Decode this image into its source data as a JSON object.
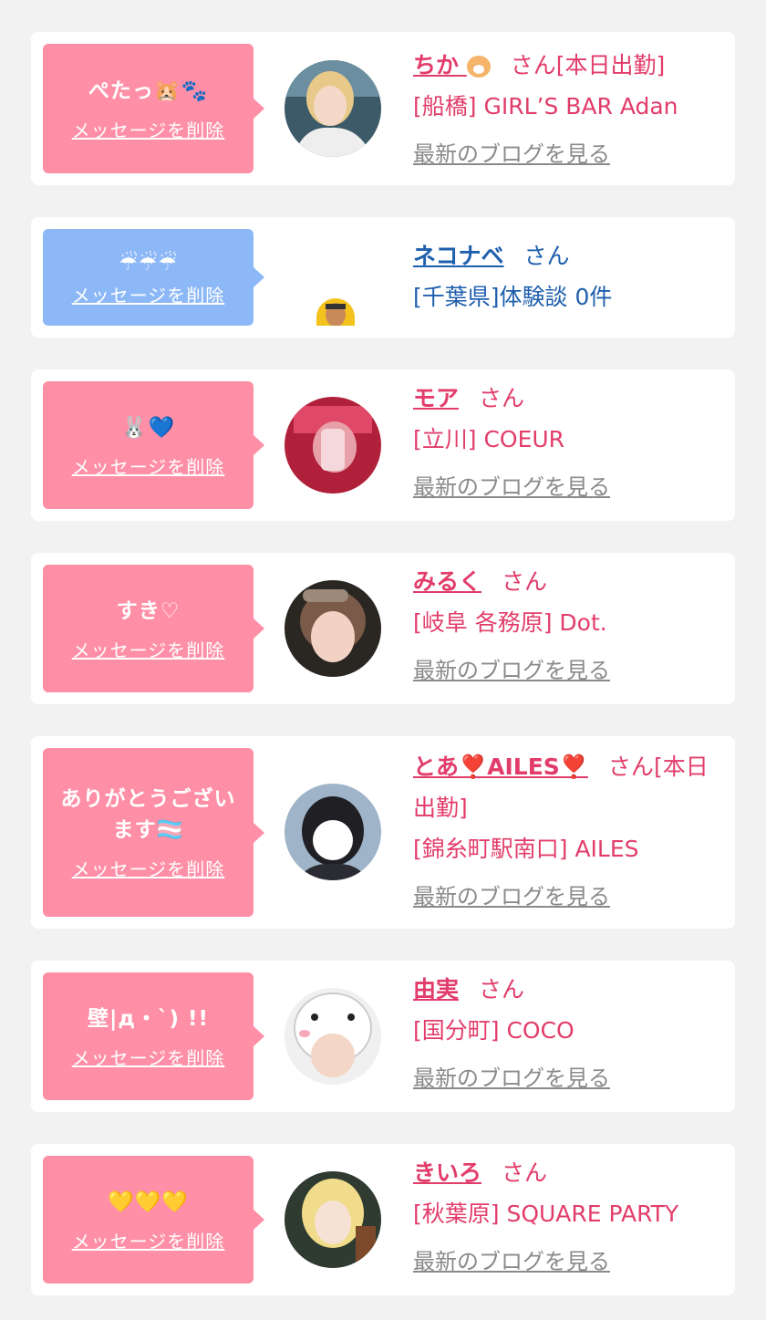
{
  "delete_label": "メッセージを削除",
  "blog_label": "最新のブログを見る",
  "san_label": "さん",
  "messages": [
    {
      "bubble_text": "ぺたっ🐹🐾",
      "name": "ちか",
      "name_suffix": "🐹",
      "status": "[本日出勤]",
      "shop": "[船橋] GIRL’S BAR Adan",
      "has_blog": true,
      "bubble_color": "pink"
    },
    {
      "bubble_text": "☔☔☔",
      "name": "ネコナベ",
      "name_suffix": "",
      "status": "",
      "shop": "[千葉県]体験談 0件",
      "has_blog": false,
      "bubble_color": "blue"
    },
    {
      "bubble_text": "🐰💙",
      "name": "モア",
      "name_suffix": "",
      "status": "",
      "shop": "[立川] COEUR",
      "has_blog": true,
      "bubble_color": "pink"
    },
    {
      "bubble_text": "すき♡",
      "name": "みるく",
      "name_suffix": "",
      "status": "",
      "shop": "[岐阜 各務原] Dot.",
      "has_blog": true,
      "bubble_color": "pink"
    },
    {
      "bubble_text": "ありがとうございます🏳️‍⚧️",
      "name": "とあ❣️AILES❣️",
      "name_suffix": "",
      "status": "[本日出勤]",
      "shop": "[錦糸町駅南口] AILES",
      "has_blog": true,
      "bubble_color": "pink"
    },
    {
      "bubble_text": "壁|д・`) !!",
      "name": "由実",
      "name_suffix": "",
      "status": "",
      "shop": "[国分町] COCO",
      "has_blog": true,
      "bubble_color": "pink"
    },
    {
      "bubble_text": "💛💛💛",
      "name": "きいろ",
      "name_suffix": "",
      "status": "",
      "shop": "[秋葉原] SQUARE PARTY",
      "has_blog": true,
      "bubble_color": "pink"
    }
  ],
  "colors": {
    "pink_bubble": "#ff8fa6",
    "blue_bubble": "#8db8f7",
    "pink_text": "#e23d6a",
    "blue_text": "#1f5fae",
    "blog_link": "#8a8a8a",
    "background": "#f2f2f2"
  }
}
